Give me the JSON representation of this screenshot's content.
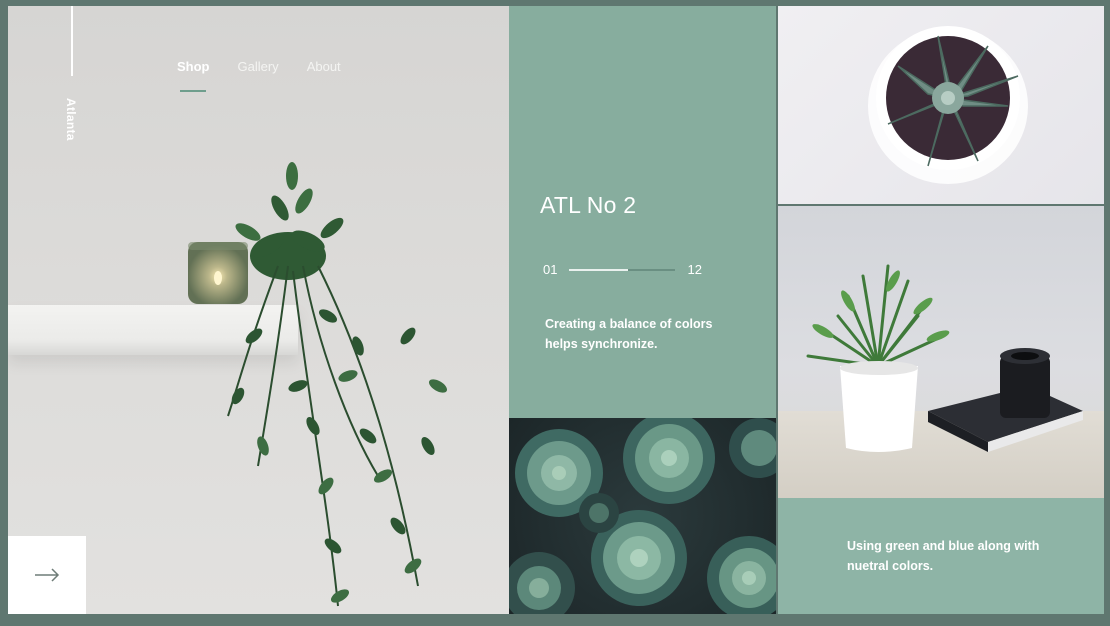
{
  "brand": "Atlanta",
  "nav": {
    "items": [
      {
        "label": "Shop",
        "active": true
      },
      {
        "label": "Gallery",
        "active": false
      },
      {
        "label": "About",
        "active": false
      }
    ]
  },
  "feature": {
    "title": "ATL No 2",
    "current": "01",
    "total": "12",
    "progress_fraction": 0.55,
    "description": "Creating a balance of colors helps synchronize."
  },
  "aside": {
    "description": "Using green and blue along with nuetral colors."
  },
  "next_button": {
    "icon": "arrow-right-icon"
  },
  "colors": {
    "accent": "#87ad9e",
    "accent_light": "#8eb4a6",
    "underline": "#6f9e8d"
  }
}
